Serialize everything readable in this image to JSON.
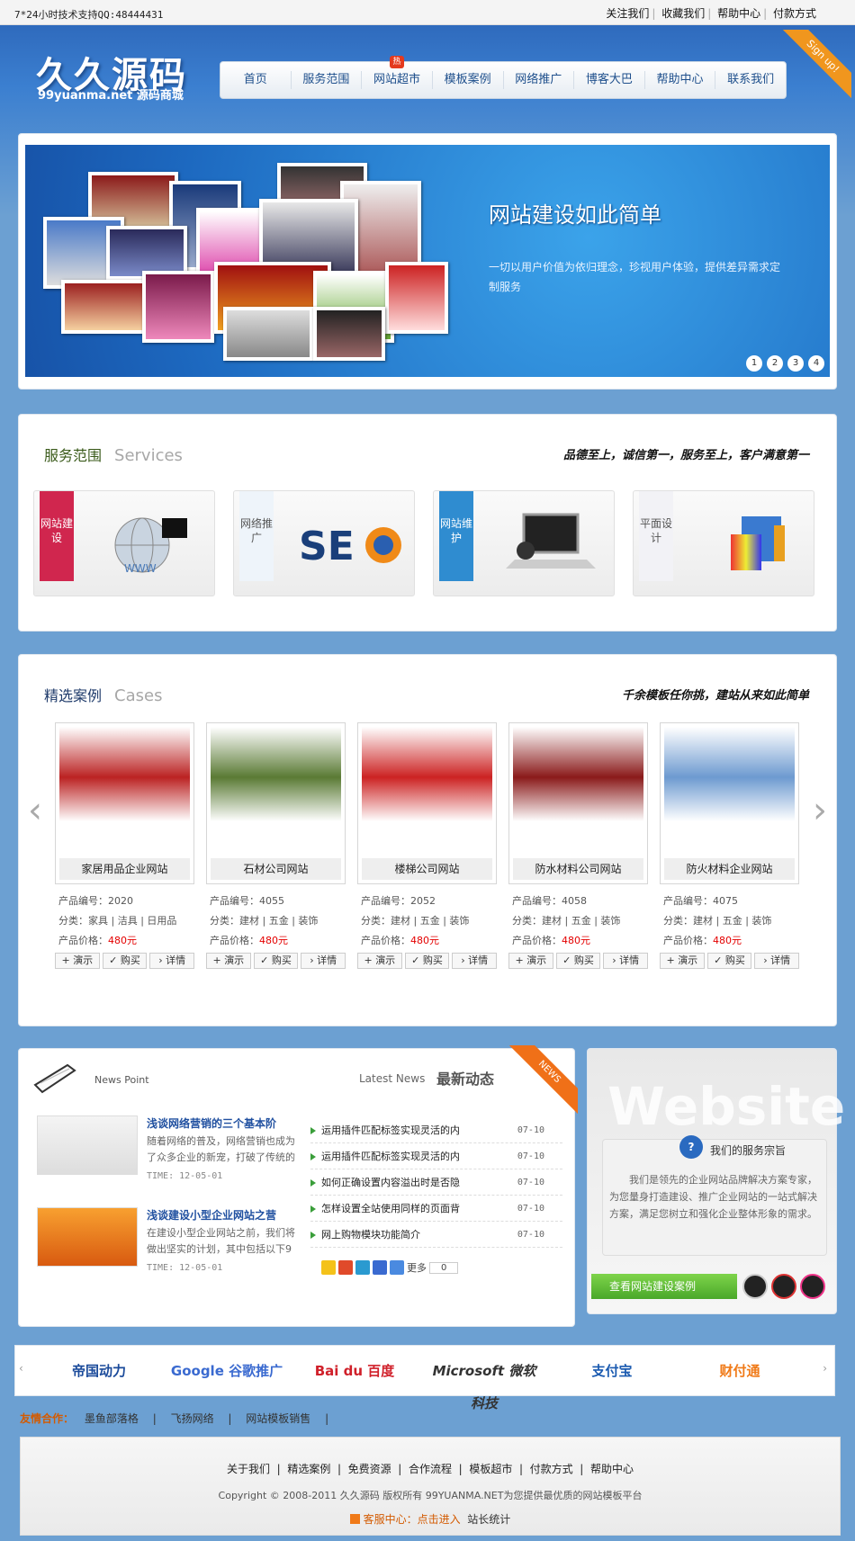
{
  "topbar": {
    "support": "7*24小时技术支持QQ:48444431",
    "links": [
      "关注我们",
      "收藏我们",
      "帮助中心",
      "付款方式"
    ]
  },
  "logo": {
    "cn": "久久源码",
    "en": "99yuanma.net 源码商城"
  },
  "nav": {
    "items": [
      "首页",
      "服务范围",
      "网站超市",
      "模板案例",
      "网络推广",
      "博客大巴",
      "帮助中心",
      "联系我们"
    ],
    "hot_badge": "热"
  },
  "signup": "Sign up!",
  "banner": {
    "title": "网站建设如此简单",
    "desc": "一切以用户价值为依归理念，珍视用户体验，提供差异需求定制服务",
    "dots": [
      "1",
      "2",
      "3",
      "4"
    ]
  },
  "services": {
    "title": "服务范围",
    "title_en": "Services",
    "slogan": "品德至上，诚信第一，服务至上，客户满意第一",
    "items": [
      {
        "label": "网站建设",
        "color": "#d0264e"
      },
      {
        "label": "网络推广",
        "color": "#5aa8dc"
      },
      {
        "label": "网站维护",
        "color": "#2f8cd0"
      },
      {
        "label": "平面设计",
        "color": "#d0264e"
      }
    ]
  },
  "cases": {
    "title": "精选案例",
    "title_en": "Cases",
    "slogan": "千余模板任你挑，建站从来如此简单",
    "labels": {
      "no": "产品编号：",
      "cat": "分类：",
      "price": "产品价格：",
      "demo": "演示",
      "buy": "购买",
      "detail": "详情"
    },
    "items": [
      {
        "name": "家居用品企业网站",
        "no": "2020",
        "cat": "家具 | 洁具 | 日用品",
        "price": "480元",
        "color": "#b22"
      },
      {
        "name": "石材公司网站",
        "no": "4055",
        "cat": "建材 | 五金 | 装饰",
        "price": "480元",
        "color": "#5a7a34"
      },
      {
        "name": "楼梯公司网站",
        "no": "2052",
        "cat": "建材 | 五金 | 装饰",
        "price": "480元",
        "color": "#c22"
      },
      {
        "name": "防水材料公司网站",
        "no": "4058",
        "cat": "建材 | 五金 | 装饰",
        "price": "480元",
        "color": "#8a1a1a"
      },
      {
        "name": "防火材料企业网站",
        "no": "4075",
        "cat": "建材 | 五金 | 装饰",
        "price": "480元",
        "color": "#6d9ad0"
      }
    ]
  },
  "news": {
    "label": "News Point",
    "latest": "Latest News",
    "title": "最新动态",
    "ribbon": "NEWS",
    "featured": [
      {
        "title": "浅谈网络营销的三个基本阶",
        "desc": "随着网络的普及，网络营销也成为了众多企业的新宠，打破了传统的",
        "time": "TIME: 12-05-01"
      },
      {
        "title": "浅谈建设小型企业网站之营",
        "desc": "在建设小型企业网站之前，我们将做出坚实的计划，其中包括以下9",
        "time": "TIME: 12-05-01"
      }
    ],
    "list": [
      {
        "t": "运用插件匹配标签实现灵活的内",
        "d": "07-10"
      },
      {
        "t": "运用插件匹配标签实现灵活的内",
        "d": "07-10"
      },
      {
        "t": "如何正确设置内容溢出时是否隐",
        "d": "07-10"
      },
      {
        "t": "怎样设置全站使用同样的页面背",
        "d": "07-10"
      },
      {
        "t": "网上购物模块功能简介",
        "d": "07-10"
      }
    ],
    "share_more": "更多",
    "share_count": "0"
  },
  "website": {
    "bg": "Website",
    "title": "我们的服务宗旨",
    "desc": "我们是领先的企业网站品牌解决方案专家，为您量身打造建设、推广企业网站的一站式解决方案，满足您树立和强化企业整体形象的需求。",
    "button": "查看网站建设案例"
  },
  "partners": [
    "帝国动力",
    "Google 谷歌推广",
    "Bai du 百度",
    "Microsoft 微软科技",
    "支付宝",
    "财付通"
  ],
  "friends": {
    "label": "友情合作：",
    "links": [
      "墨鱼部落格",
      "飞扬网络",
      "网站模板销售"
    ]
  },
  "footer": {
    "links": [
      "关于我们",
      "精选案例",
      "免费资源",
      "合作流程",
      "模板超市",
      "付款方式",
      "帮助中心"
    ],
    "copyright": "Copyright © 2008-2011 久久源码 版权所有 99YUANMA.NET为您提供最优质的网站模板平台",
    "service": "客服中心：",
    "service_link": "点击进入",
    "stats": "站长统计"
  }
}
